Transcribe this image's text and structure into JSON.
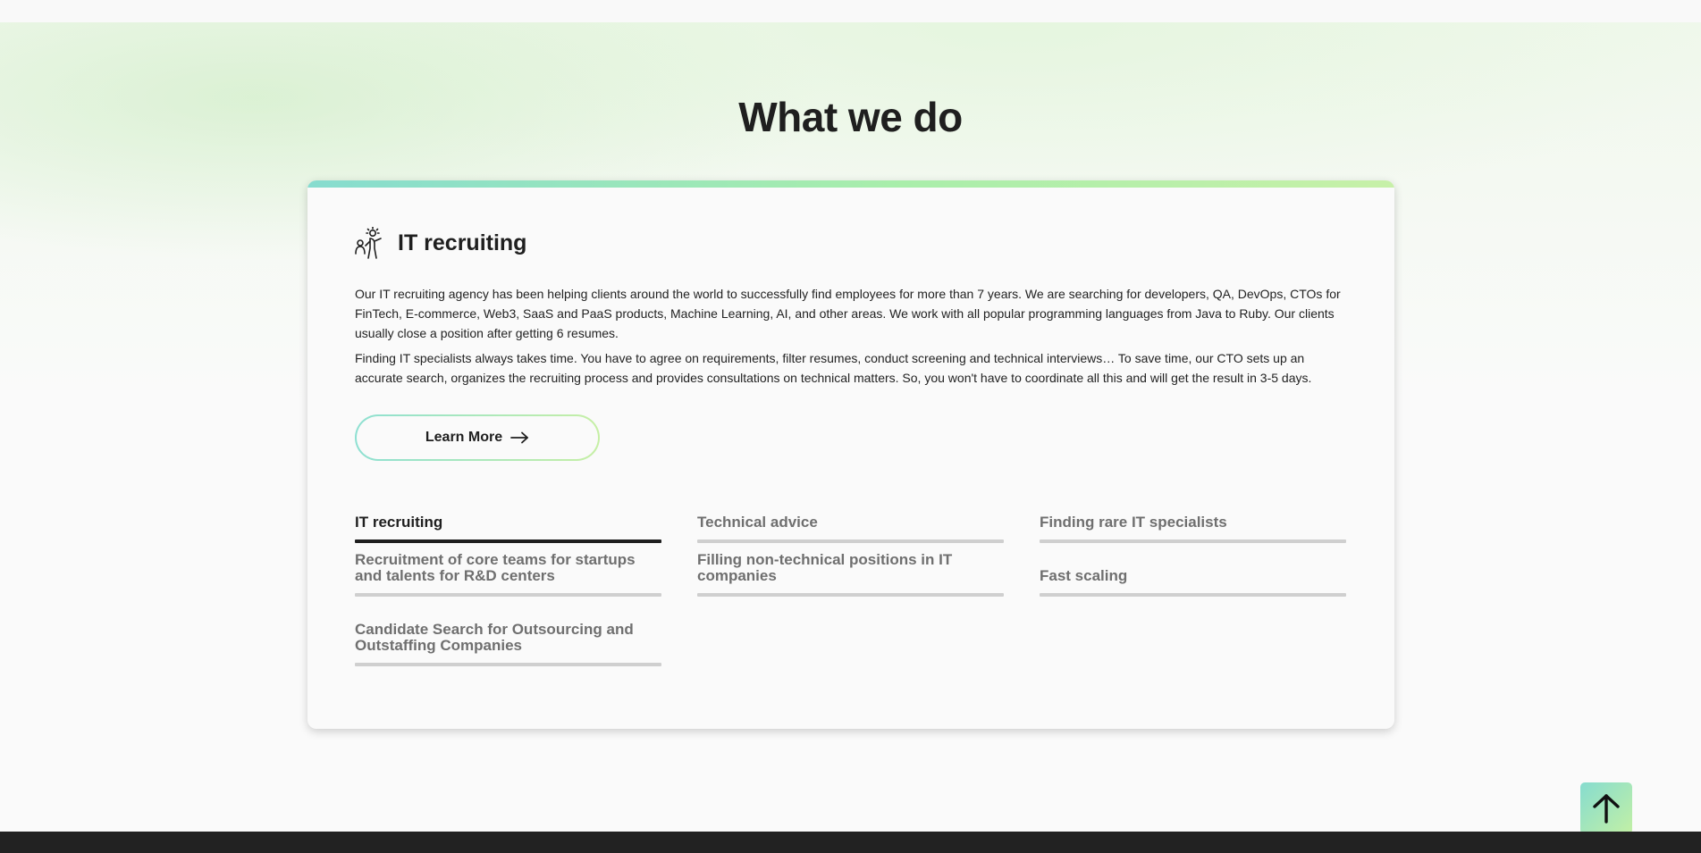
{
  "section": {
    "title": "What we do"
  },
  "card": {
    "title": "IT recruiting",
    "icon": "recruiter-people-icon",
    "paragraphs": [
      "Our IT recruiting agency has been helping clients around the world to successfully find employees for more than 7 years. We are searching for developers, QA, DevOps, CTOs for FinTech, E-commerce, Web3, SaaS and PaaS products, Machine Learning, AI, and other areas. We work with all popular programming languages from Java to Ruby. Our clients usually close a position after getting 6 resumes.",
      "Finding IT specialists always takes time. You have to agree on requirements, filter resumes, conduct screening and technical interviews… To save time, our CTO sets up an accurate search, organizes the recruiting process and provides consultations on technical matters. So, you won't have to coordinate all this and will get the result in 3-5 days."
    ],
    "learn_more_label": "Learn More"
  },
  "tabs": [
    {
      "label": "IT recruiting",
      "active": true
    },
    {
      "label": "Technical advice",
      "active": false
    },
    {
      "label": "Finding rare IT specialists",
      "active": false
    },
    {
      "label": "Recruitment of core teams for startups and talents for R&D centers",
      "active": false
    },
    {
      "label": "Filling non-technical positions in IT companies",
      "active": false
    },
    {
      "label": "Fast scaling",
      "active": false
    },
    {
      "label": "Candidate Search for Outsourcing and Outstaffing Companies",
      "active": false
    }
  ],
  "colors": {
    "accent_start": "#86dccf",
    "accent_end": "#c6efa5",
    "text_dark": "#1f1f1f",
    "tab_inactive": "#6f6f6f",
    "footer": "#222222"
  }
}
